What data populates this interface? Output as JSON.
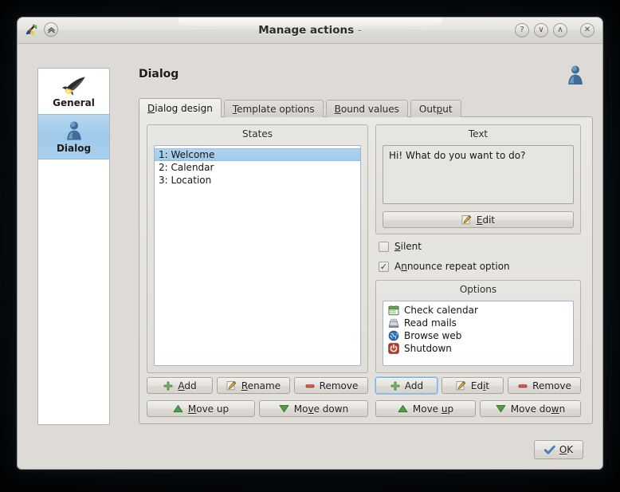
{
  "window": {
    "title": "Manage actions",
    "title_suffix": "-",
    "app_icon": "simon-app-icon",
    "shade_button": "shade-icon",
    "controls": [
      {
        "name": "help-button",
        "glyph": "?"
      },
      {
        "name": "minimize-button",
        "glyph": "∨"
      },
      {
        "name": "maximize-button",
        "glyph": "∧"
      },
      {
        "name": "close-button",
        "glyph": "✕"
      }
    ]
  },
  "sidebar": {
    "items": [
      {
        "label": "General",
        "icon": "rocket-icon",
        "selected": false
      },
      {
        "label": "Dialog",
        "icon": "user-icon",
        "selected": true
      }
    ]
  },
  "page": {
    "title": "Dialog",
    "avatar_icon": "user-avatar-icon"
  },
  "tabs": [
    {
      "label": "Dialog design",
      "accel": "D",
      "active": true
    },
    {
      "label": "Template options",
      "accel": "T",
      "active": false
    },
    {
      "label": "Bound values",
      "accel": "B",
      "active": false
    },
    {
      "label": "Output",
      "accel": "p",
      "active": false
    }
  ],
  "states": {
    "group_title": "States",
    "items": [
      {
        "label": "1: Welcome",
        "selected": true
      },
      {
        "label": "2: Calendar",
        "selected": false
      },
      {
        "label": "3: Location",
        "selected": false
      }
    ],
    "buttons": {
      "add": "Add",
      "add_accel": "A",
      "rename": "Rename",
      "rename_accel": "R",
      "remove": "Remove",
      "move_up": "Move up",
      "move_up_accel": "M",
      "move_down": "Move down",
      "move_down_accel": "v"
    }
  },
  "text_panel": {
    "group_title": "Text",
    "value": "Hi! What do you want to do?",
    "edit_button": "Edit",
    "edit_accel": "E"
  },
  "checkboxes": [
    {
      "label": "Silent",
      "accel": "S",
      "checked": false
    },
    {
      "label": "Announce repeat option",
      "accel": "n",
      "checked": true
    }
  ],
  "options": {
    "group_title": "Options",
    "items": [
      {
        "label": "Check calendar",
        "icon": "calendar-icon"
      },
      {
        "label": "Read mails",
        "icon": "mail-icon"
      },
      {
        "label": "Browse web",
        "icon": "globe-icon"
      },
      {
        "label": "Shutdown",
        "icon": "power-icon"
      }
    ],
    "buttons": {
      "add": "Add",
      "edit": "Edit",
      "edit_accel": "i",
      "remove": "Remove",
      "move_up": "Move up",
      "move_up_accel": "u",
      "move_down": "Move down",
      "move_down_accel": "w"
    }
  },
  "footer": {
    "ok_label": "OK",
    "ok_accel": "O",
    "ok_icon": "checkmark-icon"
  },
  "colors": {
    "selection": "#a8d0ec",
    "window_bg": "#dedbd6",
    "panel_bg": "#e8e6e2",
    "list_bg": "#ffffff",
    "accent_green": "#4f9f48",
    "accent_red": "#c6413c",
    "accent_blue": "#4a7fb5"
  }
}
